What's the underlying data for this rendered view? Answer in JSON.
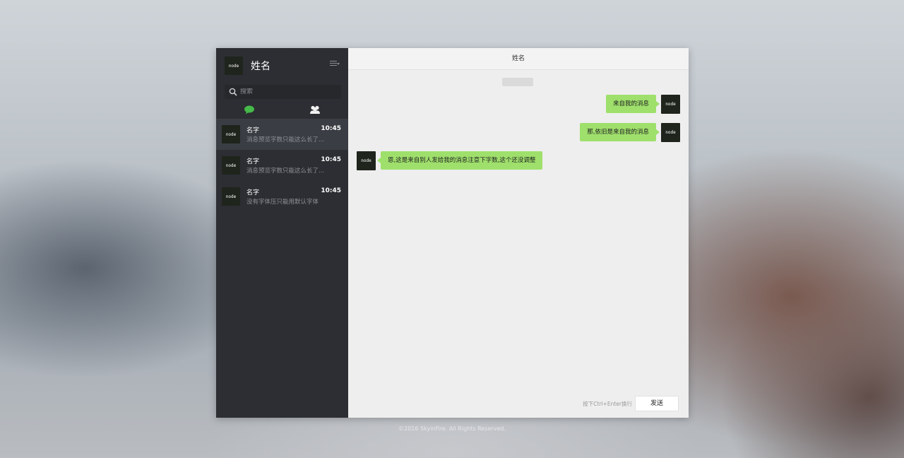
{
  "sidebar": {
    "user_name": "姓名",
    "avatar_text": "node",
    "search_placeholder": "搜索",
    "contacts": [
      {
        "name": "名字",
        "time": "10:45",
        "preview": "消息预览字数只能这么长了..."
      },
      {
        "name": "名字",
        "time": "10:45",
        "preview": "消息预览字数只能这么长了..."
      },
      {
        "name": "名字",
        "time": "10:45",
        "preview": "没有字体压只能用默认字体"
      }
    ]
  },
  "chat": {
    "title": "姓名",
    "messages": [
      {
        "side": "right",
        "text": "来自我的消息"
      },
      {
        "side": "right",
        "text": "那,依旧是来自我的消息"
      },
      {
        "side": "left",
        "text": "恩,这是来自别人发给我的消息注意下字数,这个还没调整"
      }
    ],
    "send_hint": "按下Ctrl+Enter换行",
    "send_label": "发送"
  },
  "footer": {
    "copyright": "©2016 SkyinFire. All Rights Reserved."
  },
  "colors": {
    "sidebar_bg": "#2c2e33",
    "bubble": "#9fe06c",
    "accent_green": "#4caf50",
    "main_bg": "#eeeeee"
  }
}
